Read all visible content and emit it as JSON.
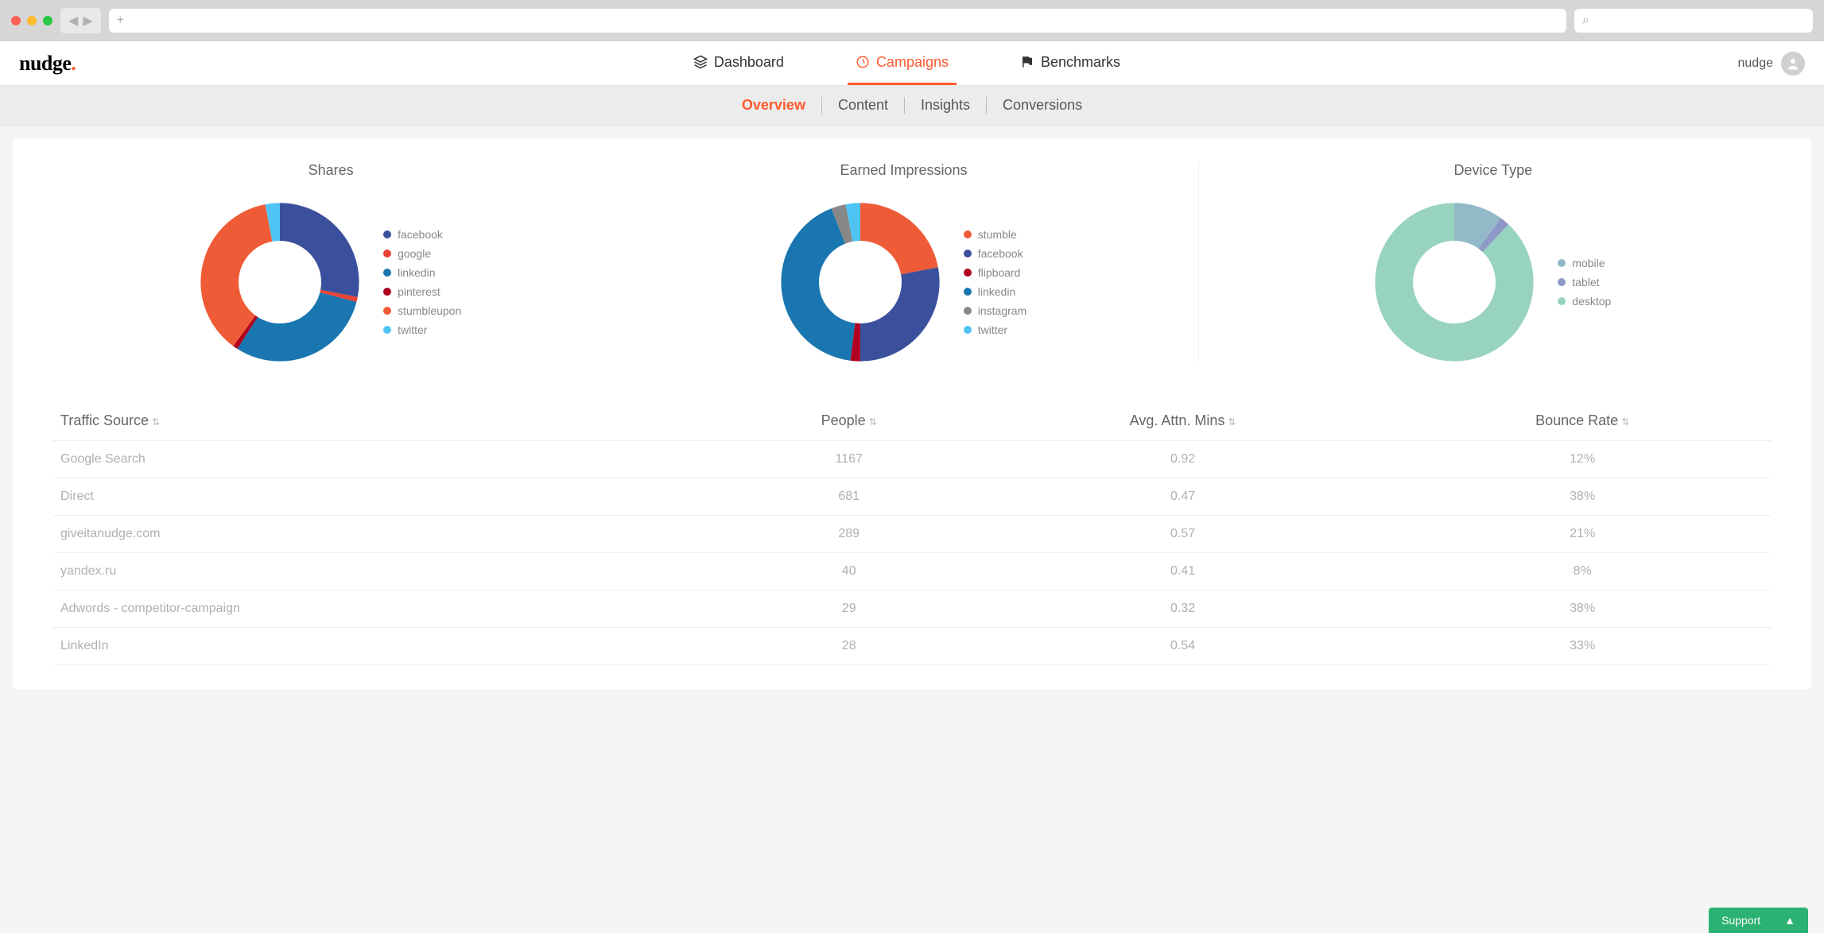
{
  "logo": "nudge",
  "nav": {
    "items": [
      {
        "label": "Dashboard",
        "active": false
      },
      {
        "label": "Campaigns",
        "active": true
      },
      {
        "label": "Benchmarks",
        "active": false
      }
    ],
    "user_label": "nudge"
  },
  "subnav": {
    "items": [
      {
        "label": "Overview",
        "active": true
      },
      {
        "label": "Content",
        "active": false
      },
      {
        "label": "Insights",
        "active": false
      },
      {
        "label": "Conversions",
        "active": false
      }
    ]
  },
  "charts": {
    "shares": {
      "title": "Shares"
    },
    "earned": {
      "title": "Earned Impressions"
    },
    "device": {
      "title": "Device Type"
    }
  },
  "chart_data": [
    {
      "type": "pie",
      "title": "Shares",
      "series": [
        {
          "name": "facebook",
          "value": 28,
          "color": "#3b509d"
        },
        {
          "name": "google",
          "value": 1,
          "color": "#e94335"
        },
        {
          "name": "linkedin",
          "value": 30,
          "color": "#1976b0"
        },
        {
          "name": "pinterest",
          "value": 1,
          "color": "#b00020"
        },
        {
          "name": "stumbleupon",
          "value": 37,
          "color": "#ef5b36"
        },
        {
          "name": "twitter",
          "value": 3,
          "color": "#4fc4f4"
        }
      ]
    },
    {
      "type": "pie",
      "title": "Earned Impressions",
      "series": [
        {
          "name": "stumble",
          "value": 22,
          "color": "#ef5b36"
        },
        {
          "name": "facebook",
          "value": 28,
          "color": "#3b509d"
        },
        {
          "name": "flipboard",
          "value": 2,
          "color": "#b00020"
        },
        {
          "name": "linkedin",
          "value": 42,
          "color": "#1976b0"
        },
        {
          "name": "instagram",
          "value": 3,
          "color": "#888888"
        },
        {
          "name": "twitter",
          "value": 3,
          "color": "#4fc4f4"
        }
      ]
    },
    {
      "type": "pie",
      "title": "Device Type",
      "series": [
        {
          "name": "mobile",
          "value": 10,
          "color": "#93b9c8"
        },
        {
          "name": "tablet",
          "value": 2,
          "color": "#8d99c6"
        },
        {
          "name": "desktop",
          "value": 88,
          "color": "#98d3bf"
        }
      ]
    }
  ],
  "table": {
    "headers": {
      "source": "Traffic Source",
      "people": "People",
      "attn": "Avg. Attn. Mins",
      "bounce": "Bounce Rate"
    },
    "rows": [
      {
        "source": "Google Search",
        "people": "1167",
        "attn": "0.92",
        "bounce": "12%"
      },
      {
        "source": "Direct",
        "people": "681",
        "attn": "0.47",
        "bounce": "38%"
      },
      {
        "source": "giveitanudge.com",
        "people": "289",
        "attn": "0.57",
        "bounce": "21%"
      },
      {
        "source": "yandex.ru",
        "people": "40",
        "attn": "0.41",
        "bounce": "8%"
      },
      {
        "source": "Adwords - competitor-campaign",
        "people": "29",
        "attn": "0.32",
        "bounce": "38%"
      },
      {
        "source": "LinkedIn",
        "people": "28",
        "attn": "0.54",
        "bounce": "33%"
      }
    ]
  },
  "support": {
    "label": "Support"
  }
}
